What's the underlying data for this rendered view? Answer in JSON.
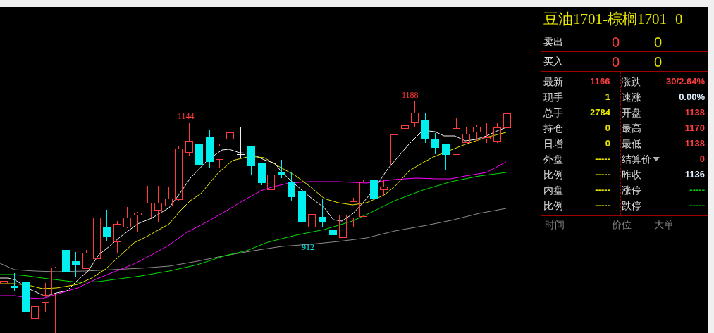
{
  "chart": {
    "labels": [
      {
        "text": "1144",
        "kind": "high"
      },
      {
        "text": "1188",
        "kind": "high"
      },
      {
        "text": "912",
        "kind": "low"
      }
    ]
  },
  "panel": {
    "title": "豆油1701-棕榈1701",
    "title_value": "0",
    "order_book": [
      {
        "label": "卖出",
        "price": "0",
        "volume": "0"
      },
      {
        "label": "买入",
        "price": "0",
        "volume": "0"
      }
    ],
    "quotes": [
      {
        "cells": [
          {
            "label": "最新",
            "value": "1166",
            "color": "#ff3c3c"
          },
          {
            "label": "涨跌",
            "value": "30/2.64%",
            "color": "#ff3c3c"
          }
        ]
      },
      {
        "cells": [
          {
            "label": "现手",
            "value": "1",
            "color": "#e8e800"
          },
          {
            "label": "速涨",
            "value": "0.00%",
            "color": "#e0f0ff"
          }
        ]
      },
      {
        "cells": [
          {
            "label": "总手",
            "value": "2784",
            "color": "#e8e800"
          },
          {
            "label": "开盘",
            "value": "1138",
            "color": "#ff3c3c"
          }
        ]
      },
      {
        "cells": [
          {
            "label": "持仓",
            "value": "0",
            "color": "#e8e800"
          },
          {
            "label": "最高",
            "value": "1170",
            "color": "#ff3c3c"
          }
        ]
      },
      {
        "cells": [
          {
            "label": "日增",
            "value": "0",
            "color": "#e8e800"
          },
          {
            "label": "最低",
            "value": "1138",
            "color": "#ff3c3c"
          }
        ]
      },
      {
        "cells": [
          {
            "label": "外盘",
            "value": "-----",
            "color": "#e8e800"
          },
          {
            "label": "结算价",
            "dropdown": true,
            "value": "0",
            "color": "#ff3c3c"
          }
        ]
      },
      {
        "cells": [
          {
            "label": "比例",
            "value": "-----",
            "color": "#e8e800"
          },
          {
            "label": "昨收",
            "value": "1136",
            "color": "#e0f0ff"
          }
        ]
      },
      {
        "cells": [
          {
            "label": "内盘",
            "value": "-----",
            "color": "#e8e800"
          },
          {
            "label": "涨停",
            "value": "-----",
            "color": "#00d000"
          }
        ]
      },
      {
        "cells": [
          {
            "label": "比例",
            "value": "-----",
            "color": "#e8e800"
          },
          {
            "label": "跌停",
            "value": "-----",
            "color": "#00d000"
          }
        ]
      }
    ],
    "trades_columns": [
      "时间",
      "价位",
      "大单"
    ]
  }
}
